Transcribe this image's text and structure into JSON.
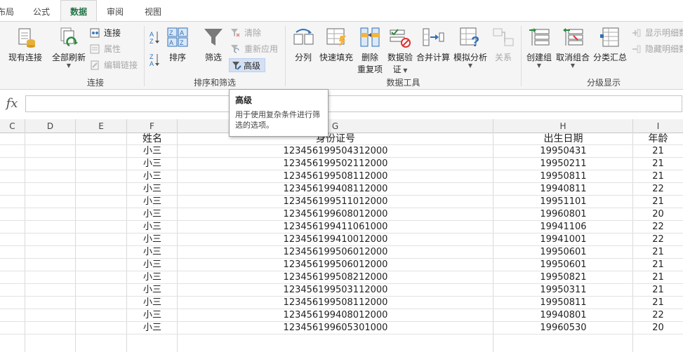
{
  "tabs": [
    {
      "label": "布局",
      "active": false
    },
    {
      "label": "公式",
      "active": false
    },
    {
      "label": "数据",
      "active": true
    },
    {
      "label": "审阅",
      "active": false
    },
    {
      "label": "视图",
      "active": false
    }
  ],
  "ribbon": {
    "connections": {
      "group_name": "连接",
      "existing": "现有连接",
      "refresh_all": "全部刷新",
      "connections": "连接",
      "properties": "属性",
      "edit_links": "编辑链接"
    },
    "sort_filter": {
      "group_name": "排序和筛选",
      "sort": "排序",
      "filter": "筛选",
      "clear": "清除",
      "reapply": "重新应用",
      "advanced": "高级"
    },
    "data_tools": {
      "group_name": "数据工具",
      "text_to_columns": "分列",
      "flash_fill": "快速填充",
      "remove_dup_1": "删除",
      "remove_dup_2": "重复项",
      "validation_1": "数据验",
      "validation_2": "证",
      "consolidate": "合并计算",
      "what_if": "模拟分析",
      "relationships": "关系"
    },
    "outline": {
      "group_name": "分级显示",
      "group": "创建组",
      "ungroup": "取消组合",
      "subtotal": "分类汇总",
      "show_detail": "显示明细数据",
      "hide_detail": "隐藏明细数据"
    }
  },
  "tooltip": {
    "title": "高级",
    "body": "用于使用复杂条件进行筛选的选项。"
  },
  "formula_bar": {
    "fx": "fx",
    "value": ""
  },
  "columns": [
    "C",
    "D",
    "E",
    "F",
    "G",
    "H",
    "I"
  ],
  "table": {
    "headers": [
      "姓名",
      "身份证号",
      "出生日期",
      "年龄"
    ],
    "rows": [
      [
        "小三",
        "123456199504312000",
        "19950431",
        "21"
      ],
      [
        "小三",
        "123456199502112000",
        "19950211",
        "21"
      ],
      [
        "小三",
        "123456199508112000",
        "19950811",
        "21"
      ],
      [
        "小三",
        "123456199408112000",
        "19940811",
        "22"
      ],
      [
        "小三",
        "123456199511012000",
        "19951101",
        "21"
      ],
      [
        "小三",
        "123456199608012000",
        "19960801",
        "20"
      ],
      [
        "小三",
        "123456199411061000",
        "19941106",
        "22"
      ],
      [
        "小三",
        "123456199410012000",
        "19941001",
        "22"
      ],
      [
        "小三",
        "123456199506012000",
        "19950601",
        "21"
      ],
      [
        "小三",
        "123456199506012000",
        "19950601",
        "21"
      ],
      [
        "小三",
        "123456199508212000",
        "19950821",
        "21"
      ],
      [
        "小三",
        "123456199503112000",
        "19950311",
        "21"
      ],
      [
        "小三",
        "123456199508112000",
        "19950811",
        "21"
      ],
      [
        "小三",
        "123456199408012000",
        "19940801",
        "22"
      ],
      [
        "小三",
        "123456199605301000",
        "19960530",
        "20"
      ]
    ]
  },
  "colors": {
    "accent": "#217346",
    "highlight": "#d5e1f2"
  }
}
